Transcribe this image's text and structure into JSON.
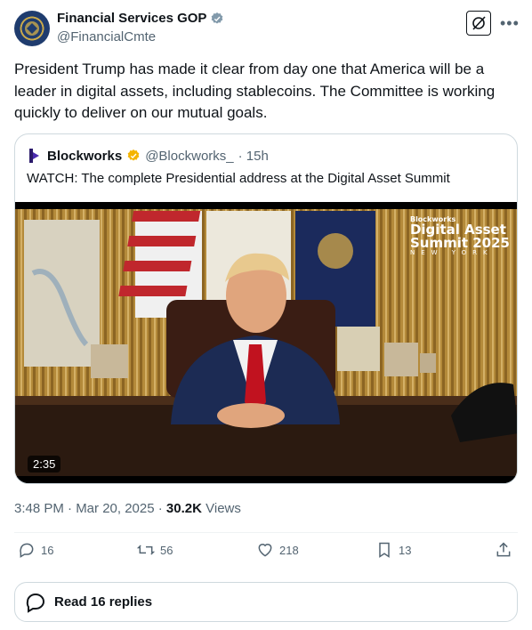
{
  "author": {
    "name": "Financial Services GOP",
    "handle": "@FinancialCmte",
    "verified_color": "#829aab"
  },
  "tweet": {
    "text": "President Trump has made it clear from day one that America will be a leader in digital assets, including stablecoins. The Committee is working quickly to deliver on our mutual goals."
  },
  "quote": {
    "name": "Blockworks",
    "handle": "@Blockworks_",
    "time": "· 15h",
    "text": "WATCH: The complete Presidential address at the Digital Asset Summit",
    "video": {
      "duration": "2:35",
      "brand_small": "Blockworks",
      "brand_line1": "Digital Asset",
      "brand_line2": "Summit 2025",
      "brand_city": "NEW YORK"
    }
  },
  "meta": {
    "timestamp": "3:48 PM · Mar 20, 2025 ·",
    "views_count": "30.2K",
    "views_label": "Views"
  },
  "actions": {
    "replies": "16",
    "reposts": "56",
    "likes": "218",
    "bookmarks": "13"
  },
  "read_replies_label": "Read 16 replies",
  "colors": {
    "text": "#0f1419",
    "secondary": "#536471",
    "border": "#cfd9de",
    "gold_badge": "#f4b400"
  }
}
